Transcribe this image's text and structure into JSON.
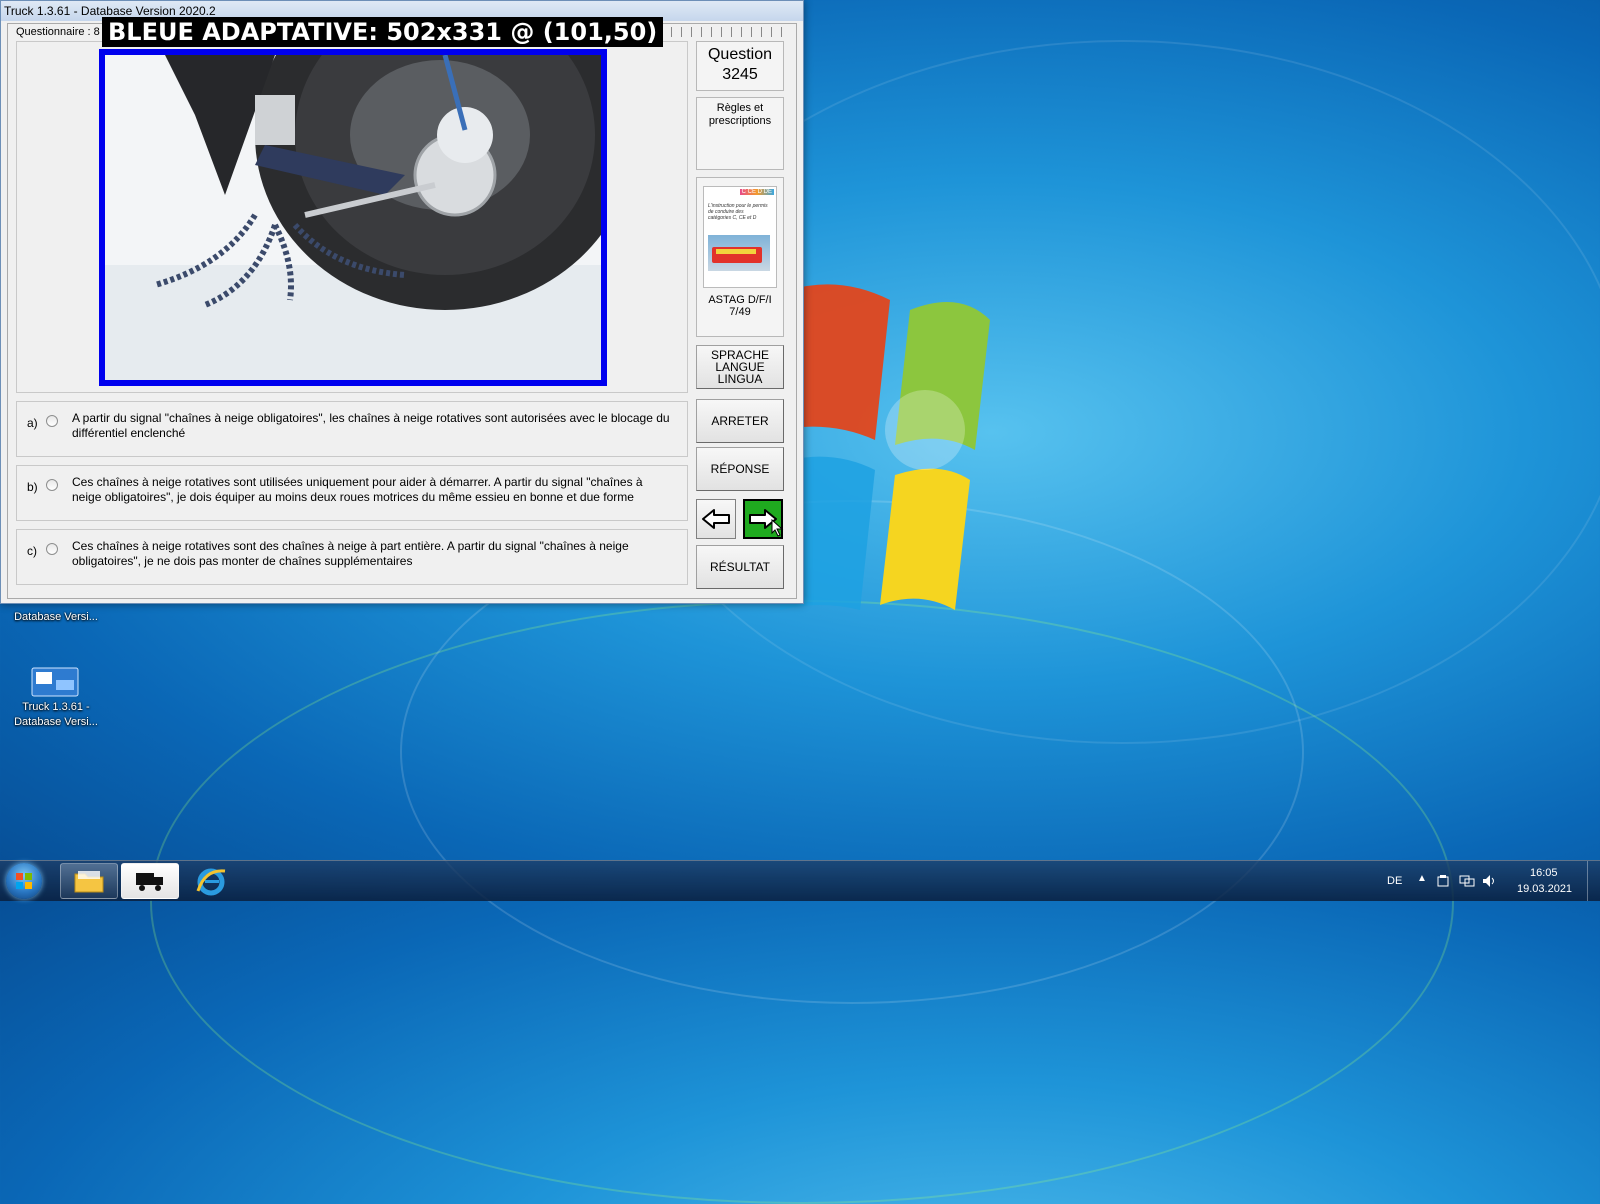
{
  "window": {
    "title": "Truck 1.3.61 - Database Version 2020.2",
    "group_label": "Questionnaire : 8",
    "overlay_label": "BLEUE ADAPTATIVE: 502x331 @ (101,50)"
  },
  "question": {
    "label": "Question",
    "number": "3245",
    "category": "Règles et prescriptions"
  },
  "book": {
    "cover_badges": "C CE D DE",
    "cover_text": "L'instruction pour le permis de conduire des catégories C, CE et D",
    "name": "ASTAG D/F/I",
    "page": "7/49"
  },
  "answers": [
    {
      "letter": "a)",
      "text": "A partir du signal \"chaînes à neige obligatoires\", les chaînes à neige rotatives sont autorisées avec le blocage du différentiel enclenché"
    },
    {
      "letter": "b)",
      "text": "Ces chaînes à neige rotatives sont utilisées uniquement pour aider à démarrer. A partir du signal \"chaînes à neige obligatoires\", je dois équiper au moins deux roues motrices du même essieu en bonne et due forme"
    },
    {
      "letter": "c)",
      "text": "Ces chaînes à neige rotatives sont des chaînes à neige à part entière. A partir du signal \"chaînes à neige obligatoires\", je ne dois pas monter de chaînes supplémentaires"
    }
  ],
  "buttons": {
    "language": "SPRACHE LANGUE LINGUA",
    "stop": "ARRETER",
    "answer": "RÉPONSE",
    "result": "RÉSULTAT"
  },
  "desktop": {
    "icon1_label": "Database Versi...",
    "icon2_label": "Truck 1.3.61 - Database Versi..."
  },
  "taskbar": {
    "language": "DE",
    "time": "16:05",
    "date": "19.03.2021"
  },
  "colors": {
    "photo_border": "#0000ee",
    "next_button": "#1faa1f"
  }
}
